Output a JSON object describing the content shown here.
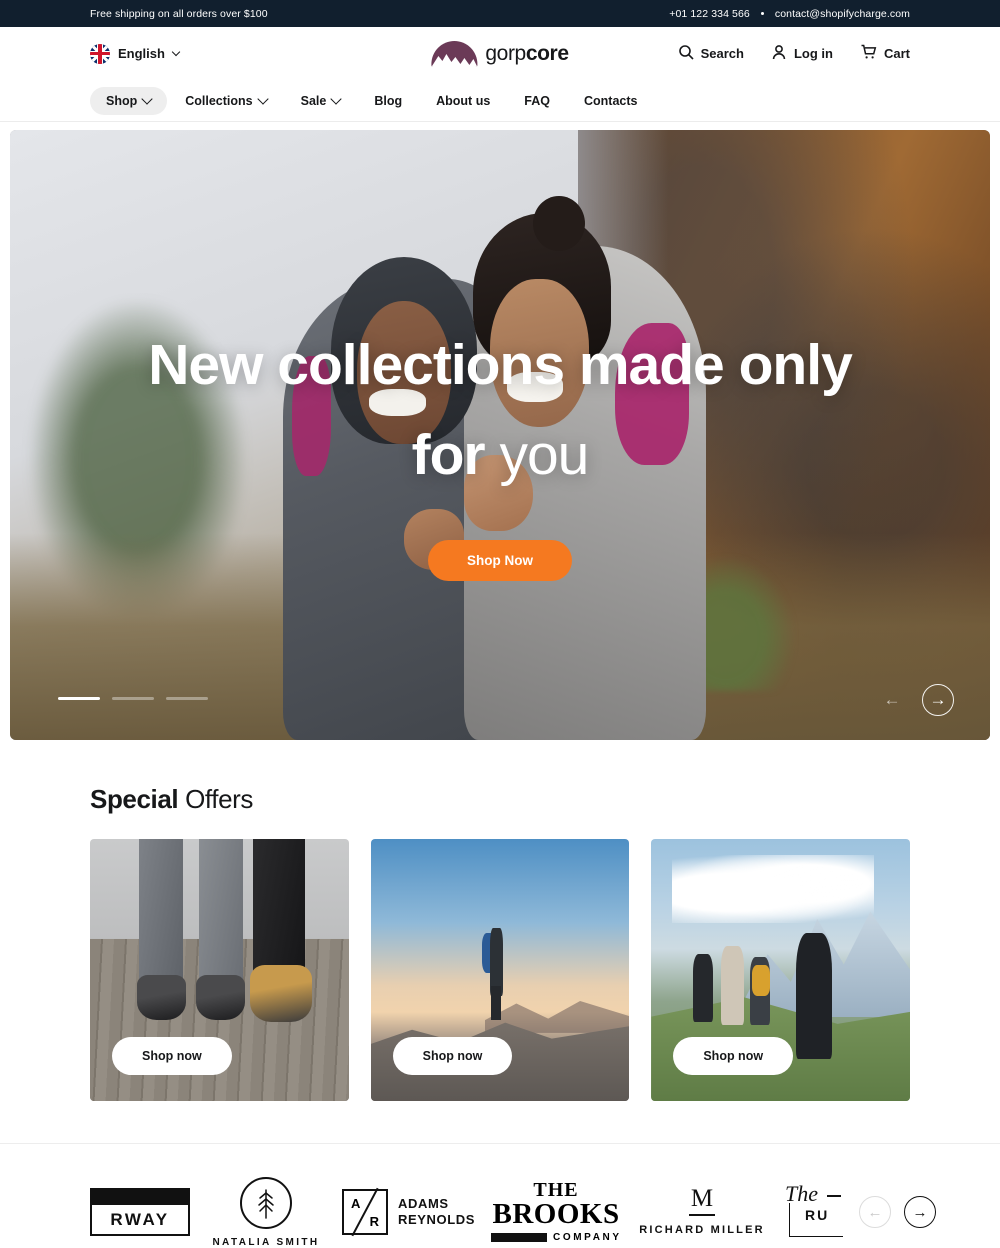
{
  "topbar": {
    "shipping": "Free shipping on all orders over $100",
    "phone": "+01 122 334 566",
    "email": "contact@shopifycharge.com"
  },
  "header": {
    "language": "English",
    "flag_icon": "uk-flag-icon",
    "logo": {
      "light": "gorp",
      "bold": "core",
      "mark_color": "#6b3a57"
    },
    "actions": [
      {
        "label": "Search",
        "icon": "search-icon"
      },
      {
        "label": "Log in",
        "icon": "user-icon"
      },
      {
        "label": "Cart",
        "icon": "cart-icon"
      }
    ]
  },
  "nav": {
    "items": [
      {
        "label": "Shop",
        "has_chevron": true,
        "active": true
      },
      {
        "label": "Collections",
        "has_chevron": true,
        "active": false
      },
      {
        "label": "Sale",
        "has_chevron": true,
        "active": false
      },
      {
        "label": "Blog",
        "has_chevron": false,
        "active": false
      },
      {
        "label": "About us",
        "has_chevron": false,
        "active": false
      },
      {
        "label": "FAQ",
        "has_chevron": false,
        "active": false
      },
      {
        "label": "Contacts",
        "has_chevron": false,
        "active": false
      }
    ]
  },
  "hero": {
    "title_bold": "New collections made only for ",
    "title_thin": "you",
    "cta": "Shop Now",
    "cta_color": "#f57920",
    "slides_total": 3,
    "slide_active": 1,
    "prev_icon": "arrow-left-icon",
    "next_icon": "arrow-right-icon"
  },
  "offers": {
    "title_bold": "Special",
    "title_thin": " Offers",
    "cards": [
      {
        "button": "Shop now",
        "alt": "three-people-boots-on-boardwalk"
      },
      {
        "button": "Shop now",
        "alt": "hiker-with-backpack-on-mountain-ridge"
      },
      {
        "button": "Shop now",
        "alt": "group-hiking-toward-snowy-mountains"
      }
    ]
  },
  "brands": {
    "items": [
      {
        "name": "RWAY",
        "id": "brand-rway"
      },
      {
        "name": "NATALIA SMITH",
        "id": "brand-natalia-smith"
      },
      {
        "line1": "ADAMS",
        "line2": "REYNOLDS",
        "mark_a": "A",
        "mark_r": "R",
        "id": "brand-adams-reynolds"
      },
      {
        "t1": "THE",
        "t2": "BROOKS",
        "t3": "COMPANY",
        "id": "brand-the-brooks-company"
      },
      {
        "mark": "M",
        "name": "RICHARD MILLER",
        "id": "brand-richard-miller"
      },
      {
        "script": "The",
        "rest": "RU",
        "id": "brand-the-ru"
      }
    ],
    "prev_icon": "arrow-left-icon",
    "next_icon": "arrow-right-icon"
  }
}
